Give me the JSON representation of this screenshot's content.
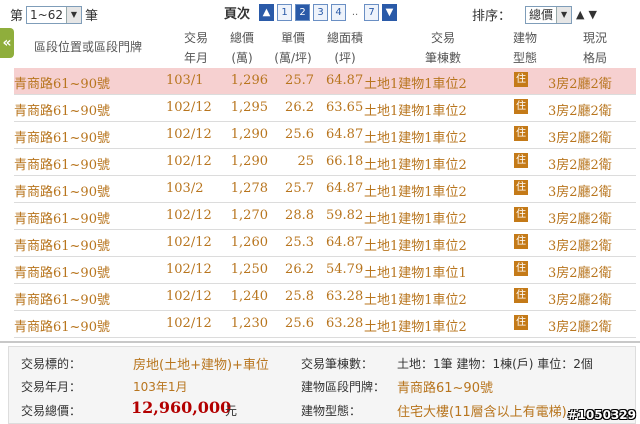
{
  "top": {
    "range_prefix": "第",
    "range_value": "1~62",
    "range_suffix": "筆",
    "pager_label": "頁次",
    "pages": [
      "1",
      "2",
      "3",
      "4",
      "7"
    ],
    "current_page": "2",
    "dots": "..",
    "sort_label": "排序：",
    "sort_value": "總價",
    "sort_up": "▲",
    "sort_down": "▼"
  },
  "sidebar_toggle": "«",
  "columns": {
    "addr": "區段位置或區段門牌",
    "date_1": "交易",
    "date_2": "年月",
    "price_1": "總價",
    "price_2": "(萬)",
    "unit_1": "單價",
    "unit_2": "(萬/坪)",
    "area_1": "總面積",
    "area_2": "(坪)",
    "parts_1": "交易",
    "parts_2": "筆棟數",
    "type_1": "建物",
    "type_2": "型態",
    "layout_1": "現況",
    "layout_2": "格局"
  },
  "rows": [
    {
      "addr": "青商路61~90號",
      "date": "103/1",
      "price": "1,296",
      "unit": "25.7",
      "area": "64.87",
      "parts": "土地1建物1車位2",
      "type": "住",
      "layout": "3房2廳2衛"
    },
    {
      "addr": "青商路61~90號",
      "date": "102/12",
      "price": "1,295",
      "unit": "26.2",
      "area": "63.65",
      "parts": "土地1建物1車位2",
      "type": "住",
      "layout": "3房2廳2衛"
    },
    {
      "addr": "青商路61~90號",
      "date": "102/12",
      "price": "1,290",
      "unit": "25.6",
      "area": "64.87",
      "parts": "土地1建物1車位2",
      "type": "住",
      "layout": "3房2廳2衛"
    },
    {
      "addr": "青商路61~90號",
      "date": "102/12",
      "price": "1,290",
      "unit": "25",
      "area": "66.18",
      "parts": "土地1建物1車位2",
      "type": "住",
      "layout": "3房2廳2衛"
    },
    {
      "addr": "青商路61~90號",
      "date": "103/2",
      "price": "1,278",
      "unit": "25.7",
      "area": "64.87",
      "parts": "土地1建物1車位2",
      "type": "住",
      "layout": "3房2廳2衛"
    },
    {
      "addr": "青商路61~90號",
      "date": "102/12",
      "price": "1,270",
      "unit": "28.8",
      "area": "59.82",
      "parts": "土地1建物1車位2",
      "type": "住",
      "layout": "3房2廳2衛"
    },
    {
      "addr": "青商路61~90號",
      "date": "102/12",
      "price": "1,260",
      "unit": "25.3",
      "area": "64.87",
      "parts": "土地1建物1車位2",
      "type": "住",
      "layout": "3房2廳2衛"
    },
    {
      "addr": "青商路61~90號",
      "date": "102/12",
      "price": "1,250",
      "unit": "26.2",
      "area": "54.79",
      "parts": "土地1建物1車位1",
      "type": "住",
      "layout": "3房2廳2衛"
    },
    {
      "addr": "青商路61~90號",
      "date": "102/12",
      "price": "1,240",
      "unit": "25.8",
      "area": "63.28",
      "parts": "土地1建物1車位2",
      "type": "住",
      "layout": "3房2廳2衛"
    },
    {
      "addr": "青商路61~90號",
      "date": "102/12",
      "price": "1,230",
      "unit": "25.6",
      "area": "63.28",
      "parts": "土地1建物1車位2",
      "type": "住",
      "layout": "3房2廳2衛"
    }
  ],
  "detail": {
    "target_label": "交易標的：",
    "target_value": "房地(土地+建物)+車位",
    "date_label": "交易年月：",
    "date_value": "103年1月",
    "total_label": "交易總價：",
    "total_value": "12,960,000",
    "total_unit": "元",
    "count_label": "交易筆棟數：",
    "count_value": "土地：1筆 建物：1棟(戶) 車位：2個",
    "addr_label": "建物區段門牌：",
    "addr_value": "青商路61~90號",
    "type_label": "建物型態：",
    "type_value": "住宅大樓(11層含以上有電梯)"
  },
  "watermark": "#1050329"
}
